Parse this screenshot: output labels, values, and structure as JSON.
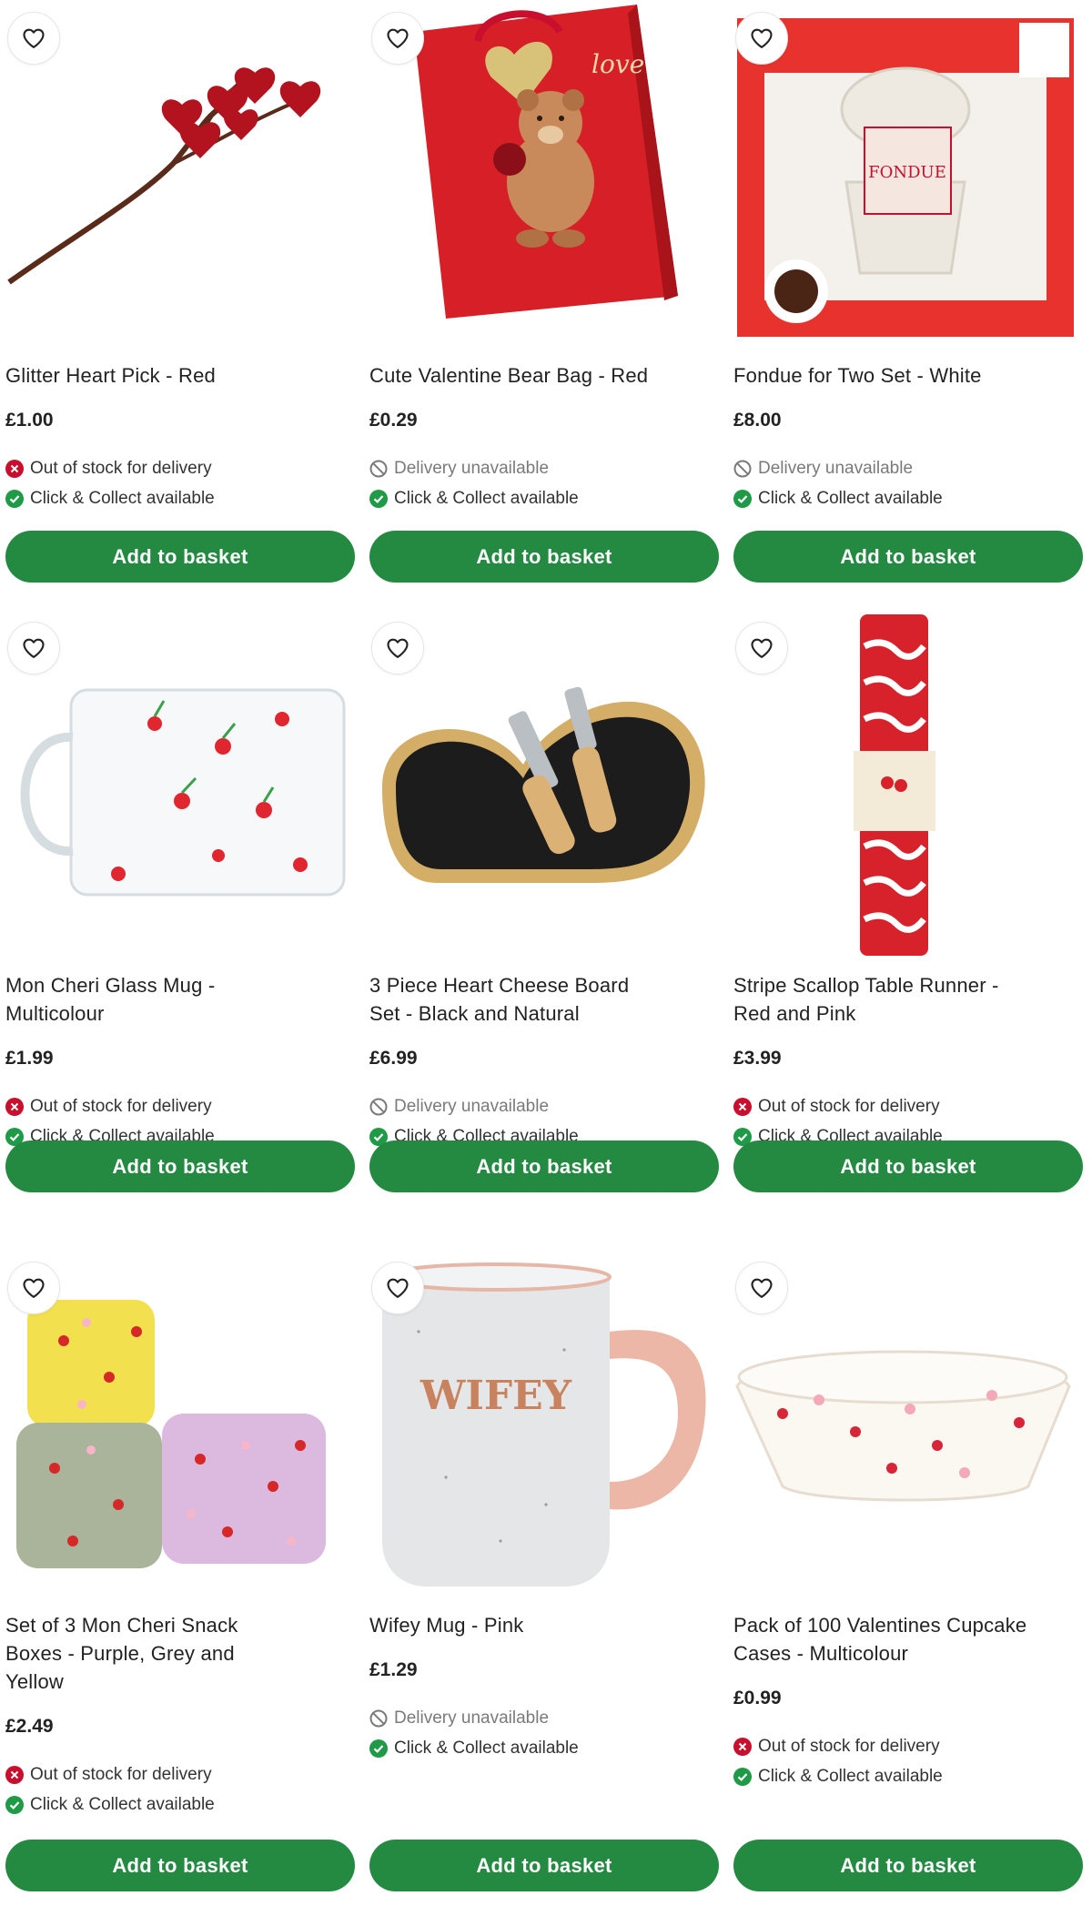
{
  "labels": {
    "add_to_basket": "Add to basket",
    "out_of_stock": "Out of stock for delivery",
    "delivery_unavailable": "Delivery unavailable",
    "click_collect": "Click & Collect available"
  },
  "colors": {
    "button_green": "#248a41",
    "status_red": "#c8102e",
    "status_green": "#1f9a46",
    "muted_grey": "#7a7a7a"
  },
  "icons": {
    "favourite": "heart-outline-icon",
    "out_of_stock": "x-circle-icon",
    "delivery_unavailable": "no-entry-icon",
    "available": "check-circle-icon"
  },
  "products": [
    {
      "title_lines": [
        "Glitter Heart Pick - Red"
      ],
      "price": "£1.00",
      "delivery": "Out of stock for delivery",
      "delivery_type": "out",
      "collect": "Click & Collect available",
      "image": "glitter-heart-pick"
    },
    {
      "title_lines": [
        "Cute Valentine Bear Bag - Red"
      ],
      "price": "£0.29",
      "delivery": "Delivery unavailable",
      "delivery_type": "unavailable",
      "collect": "Click & Collect available",
      "image": "bear-gift-bag"
    },
    {
      "title_lines": [
        "Fondue for Two Set - White"
      ],
      "price": "£8.00",
      "delivery": "Delivery unavailable",
      "delivery_type": "unavailable",
      "collect": "Click & Collect available",
      "image": "fondue-set-box"
    },
    {
      "title_lines": [
        "Mon Cheri Glass Mug -",
        "Multicolour"
      ],
      "price": "£1.99",
      "delivery": "Out of stock for delivery",
      "delivery_type": "out",
      "collect": "Click & Collect available",
      "image": "glass-mug"
    },
    {
      "title_lines": [
        "3 Piece Heart Cheese Board",
        "Set - Black and Natural"
      ],
      "price": "£6.99",
      "delivery": "Delivery unavailable",
      "delivery_type": "unavailable",
      "collect": "Click & Collect available",
      "image": "heart-cheese-board"
    },
    {
      "title_lines": [
        "Stripe Scallop Table Runner -",
        "Red and Pink"
      ],
      "price": "£3.99",
      "delivery": "Out of stock for delivery",
      "delivery_type": "out",
      "collect": "Click & Collect available",
      "image": "table-runner"
    },
    {
      "title_lines": [
        "Set of 3 Mon Cheri Snack",
        "Boxes - Purple, Grey and",
        "Yellow"
      ],
      "price": "£2.49",
      "delivery": "Out of stock for delivery",
      "delivery_type": "out",
      "collect": "Click & Collect available",
      "image": "snack-boxes"
    },
    {
      "title_lines": [
        "Wifey Mug - Pink"
      ],
      "price": "£1.29",
      "delivery": "Delivery unavailable",
      "delivery_type": "unavailable",
      "collect": "Click & Collect available",
      "image": "wifey-mug",
      "mug_text": "WIFEY"
    },
    {
      "title_lines": [
        "Pack of 100 Valentines Cupcake",
        "Cases - Multicolour"
      ],
      "price": "£0.99",
      "delivery": "Out of stock for delivery",
      "delivery_type": "out",
      "collect": "Click & Collect available",
      "image": "cupcake-cases"
    }
  ]
}
